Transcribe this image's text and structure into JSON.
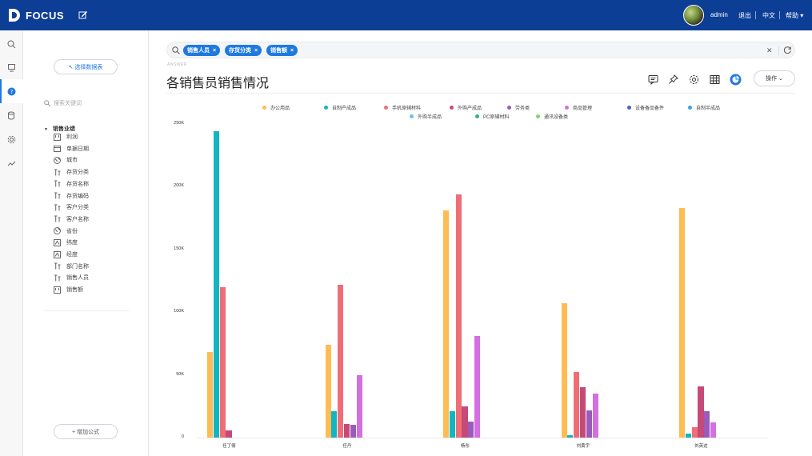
{
  "app": {
    "logo_text": "FOCUS",
    "user": "admin",
    "logout": "退出",
    "language": "中文",
    "help": "帮助"
  },
  "rail": {
    "items": [
      "search-icon",
      "board-icon",
      "question-icon",
      "data-icon",
      "settings-icon",
      "trend-icon"
    ],
    "active": "question-icon"
  },
  "panel": {
    "select_source": "↖ 选择数据表",
    "search_placeholder": "搜索关键词",
    "table_name": "销售业绩",
    "fields": [
      {
        "label": "利润",
        "icon": "measure-icon"
      },
      {
        "label": "单据日期",
        "icon": "date-icon"
      },
      {
        "label": "城市",
        "icon": "geo-icon"
      },
      {
        "label": "存货分类",
        "icon": "dimension-icon"
      },
      {
        "label": "存货名称",
        "icon": "dimension-icon"
      },
      {
        "label": "存货编码",
        "icon": "dimension-icon"
      },
      {
        "label": "客户分类",
        "icon": "dimension-icon"
      },
      {
        "label": "客户名称",
        "icon": "dimension-icon"
      },
      {
        "label": "省份",
        "icon": "geo-icon"
      },
      {
        "label": "纬度",
        "icon": "coordinate-icon"
      },
      {
        "label": "经度",
        "icon": "coordinate-icon"
      },
      {
        "label": "部门名称",
        "icon": "dimension-icon"
      },
      {
        "label": "销售人员",
        "icon": "dimension-icon"
      },
      {
        "label": "销售额",
        "icon": "measure-icon"
      }
    ],
    "add_formula": "+ 增加公式"
  },
  "query": {
    "chips": [
      "销售人员",
      "存货分类",
      "销售额"
    ]
  },
  "answer": {
    "label": "ANSWER",
    "title": "各销售员销售情况",
    "operations": "操作"
  },
  "colors": {
    "topbar": "#0d3e96",
    "accent": "#1f7ae0"
  },
  "chart_data": {
    "type": "bar",
    "categories": [
      "任丁倩",
      "任丹",
      "杨彤",
      "刘黄宇",
      "刘英这"
    ],
    "series": [
      {
        "name": "办公用品",
        "color": "#ffbc55",
        "values": [
          68000,
          74000,
          181000,
          107000,
          183000
        ]
      },
      {
        "name": "自制产成品",
        "color": "#12b5c2",
        "values": [
          244000,
          21000,
          21000,
          2000,
          3000
        ]
      },
      {
        "name": "手机原辅材料",
        "color": "#ef6e76",
        "values": [
          120000,
          122000,
          194000,
          52000,
          8000
        ]
      },
      {
        "name": "外购产成品",
        "color": "#c64a79",
        "values": [
          6000,
          11000,
          25000,
          40000,
          41000
        ]
      },
      {
        "name": "劳务类",
        "color": "#9b5bba",
        "values": [
          0,
          10000,
          13000,
          22000,
          21000
        ]
      },
      {
        "name": "商品管理",
        "color": "#d36fe0",
        "values": [
          0,
          50000,
          81000,
          35000,
          12000
        ]
      },
      {
        "name": "设备备品备件",
        "color": "#4b63c6",
        "values": [
          0,
          0,
          0,
          0,
          0
        ]
      },
      {
        "name": "自制半成品",
        "color": "#3ea0e6",
        "values": [
          0,
          0,
          0,
          0,
          0
        ]
      },
      {
        "name": "外购半成品",
        "color": "#6cc0e8",
        "values": [
          0,
          0,
          0,
          0,
          0
        ]
      },
      {
        "name": "PC原辅材料",
        "color": "#35b27f",
        "values": [
          0,
          0,
          0,
          0,
          0
        ]
      },
      {
        "name": "通讯设备类",
        "color": "#8cd06a",
        "values": [
          0,
          0,
          0,
          0,
          0
        ]
      }
    ],
    "yticks": [
      "0",
      "50K",
      "100K",
      "150K",
      "200K",
      "250K"
    ],
    "ylim": [
      0,
      250000
    ],
    "grid": false,
    "legend": "top"
  }
}
